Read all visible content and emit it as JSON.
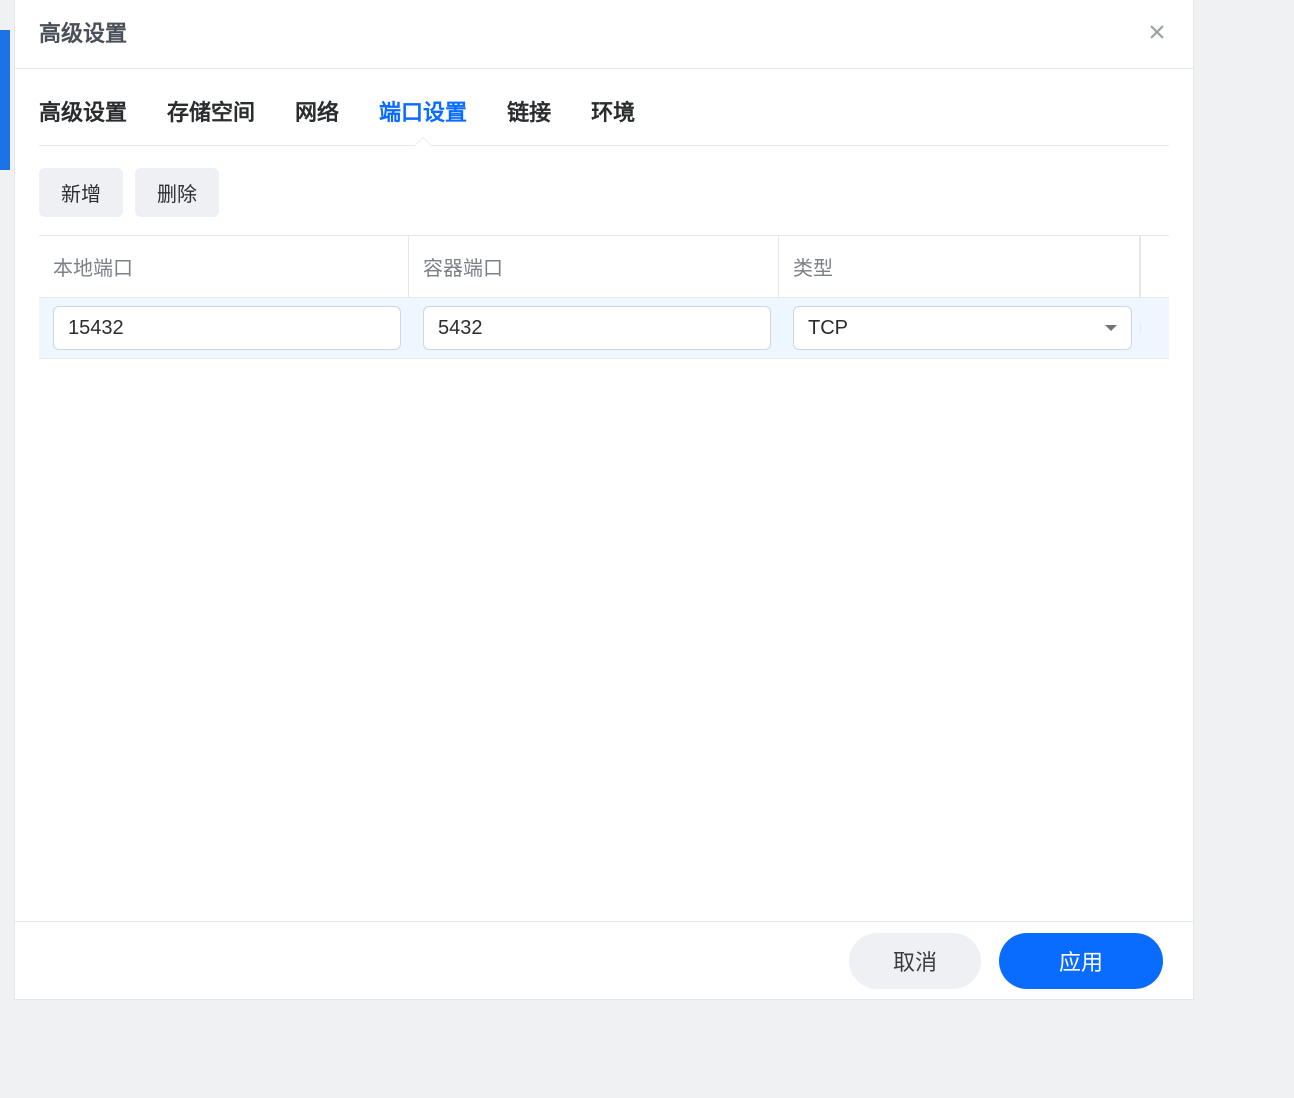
{
  "dialog": {
    "title": "高级设置"
  },
  "tabs": [
    {
      "label": "高级设置",
      "active": false
    },
    {
      "label": "存储空间",
      "active": false
    },
    {
      "label": "网络",
      "active": false
    },
    {
      "label": "端口设置",
      "active": true
    },
    {
      "label": "链接",
      "active": false
    },
    {
      "label": "环境",
      "active": false
    }
  ],
  "toolbar": {
    "add_label": "新增",
    "delete_label": "删除"
  },
  "table": {
    "headers": {
      "local_port": "本地端口",
      "container_port": "容器端口",
      "type": "类型"
    },
    "rows": [
      {
        "local_port": "15432",
        "container_port": "5432",
        "type": "TCP"
      }
    ]
  },
  "footer": {
    "cancel_label": "取消",
    "apply_label": "应用"
  }
}
